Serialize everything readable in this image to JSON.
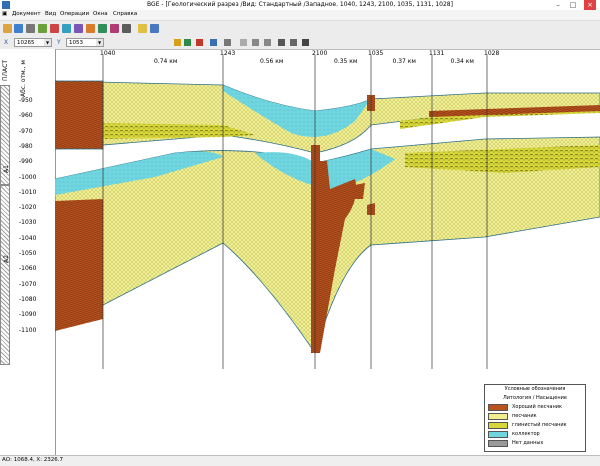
{
  "window": {
    "title": "BGE - [Геологический разрез /Вид: Стандартный /Западное. 1040, 1243, 2100, 1035, 1131, 1028]"
  },
  "menu": [
    "Документ",
    "Вид",
    "Операции",
    "Окна",
    "Справка"
  ],
  "toolbar2": {
    "field1_label": "X",
    "field1_value": "10265",
    "field2_label": "Y",
    "field2_value": "1053"
  },
  "left_panel": {
    "plast_header": "ПЛАСТ",
    "abs_header": "Абс. отм., м",
    "layers": [
      "А1",
      "А2"
    ],
    "depth_labels": [
      "-950",
      "-960",
      "-970",
      "-980",
      "-990",
      "-1000",
      "-1010",
      "-1020",
      "-1030",
      "-1040",
      "-1050",
      "-1060",
      "-1070",
      "-1080",
      "-1090",
      "-1100"
    ]
  },
  "wells": [
    {
      "name": "1040"
    },
    {
      "name": "1243"
    },
    {
      "name": "2100"
    },
    {
      "name": "1035"
    },
    {
      "name": "1131"
    },
    {
      "name": "1028"
    }
  ],
  "distances": [
    "0.74 км",
    "0.56 км",
    "0.35 км",
    "0.37 км",
    "0.34 км"
  ],
  "legend": {
    "title": "Условные обозначения",
    "subtitle": "Литология / Насыщение",
    "items": [
      {
        "label": "Хороший песчаник",
        "color": "#b8521e"
      },
      {
        "label": "песчаник",
        "color": "#f1ee90"
      },
      {
        "label": "глинистый песчаник",
        "color": "#d7d63a"
      },
      {
        "label": "коллектор",
        "color": "#6fd6e0"
      },
      {
        "label": "Нет данных",
        "color": "#9a9a9a"
      }
    ]
  },
  "status": {
    "text": "АО: 1068.4, X: 2326.7"
  },
  "colors": {
    "good_sand": "#b8521e",
    "sand": "#f1ee90",
    "clay_sand": "#d7d63a",
    "collector": "#6fd6e0",
    "boundary": "#2e6f88"
  }
}
